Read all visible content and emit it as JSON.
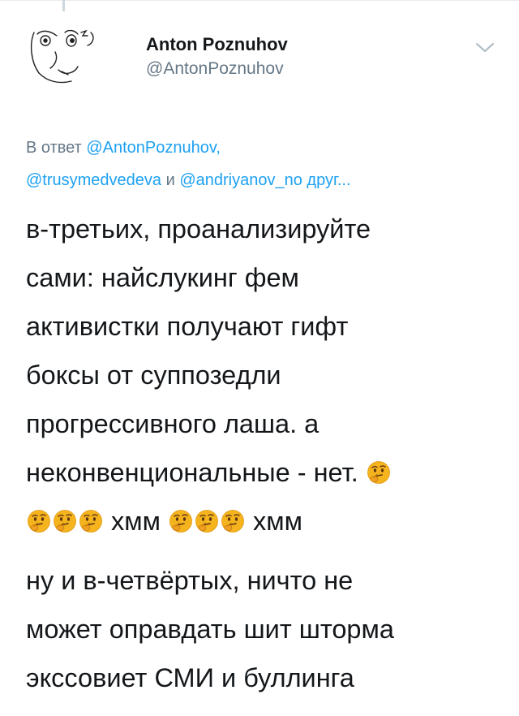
{
  "tweet": {
    "author": {
      "display_name": "Anton Poznuhov",
      "handle": "@AntonPoznuhov"
    },
    "reply_context": {
      "prefix": "В ответ",
      "mention_1": "@AntonPoznuhov,",
      "mention_2": "@trusymedvedeva",
      "conjunction": "и",
      "mention_3": "@andriyanov_no",
      "others": "друг..."
    },
    "body": {
      "line_1": "в-третьих, проанализируйте",
      "line_2": "сами: найслукинг фем",
      "line_3": "активистки получают гифт",
      "line_4": "боксы от суппозедли",
      "line_5": "прогрессивного лаша. а",
      "line_6": "неконвенциональные - нет.",
      "hmm_1": "хмм",
      "hmm_2": "хмм",
      "para2_line_1": "ну и в-четвёртых, ничто не",
      "para2_line_2": "может оправдать шит шторма",
      "para2_line_3": "экссовиет СМИ и буллинга"
    },
    "emoji_name": "thinking-face"
  },
  "colors": {
    "text": "#14171a",
    "secondary": "#657786",
    "link": "#1da1f2",
    "emoji": "#f5b31d"
  }
}
